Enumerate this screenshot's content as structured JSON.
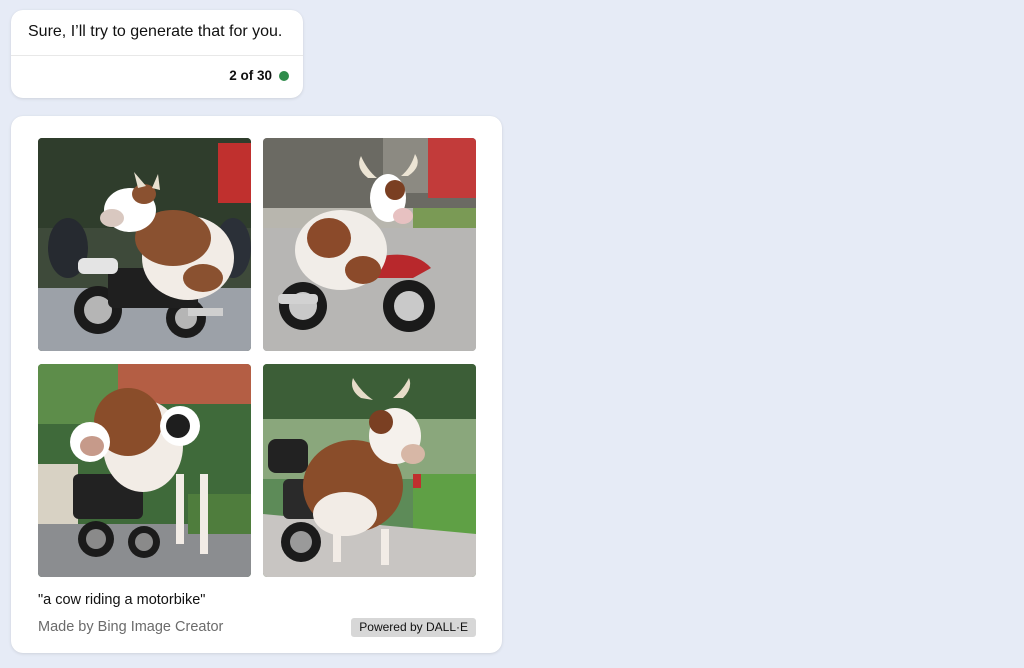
{
  "message": {
    "text": "Sure, I’ll try to generate that for you.",
    "turn_counter": "2 of 30",
    "status_color": "#2e8b4a"
  },
  "image_card": {
    "images": [
      {
        "name": "generated-image-1"
      },
      {
        "name": "generated-image-2"
      },
      {
        "name": "generated-image-3"
      },
      {
        "name": "generated-image-4"
      }
    ],
    "prompt": "\"a cow riding a motorbike\"",
    "made_by": "Made by Bing Image Creator",
    "powered_by": "Powered by DALL·E"
  }
}
